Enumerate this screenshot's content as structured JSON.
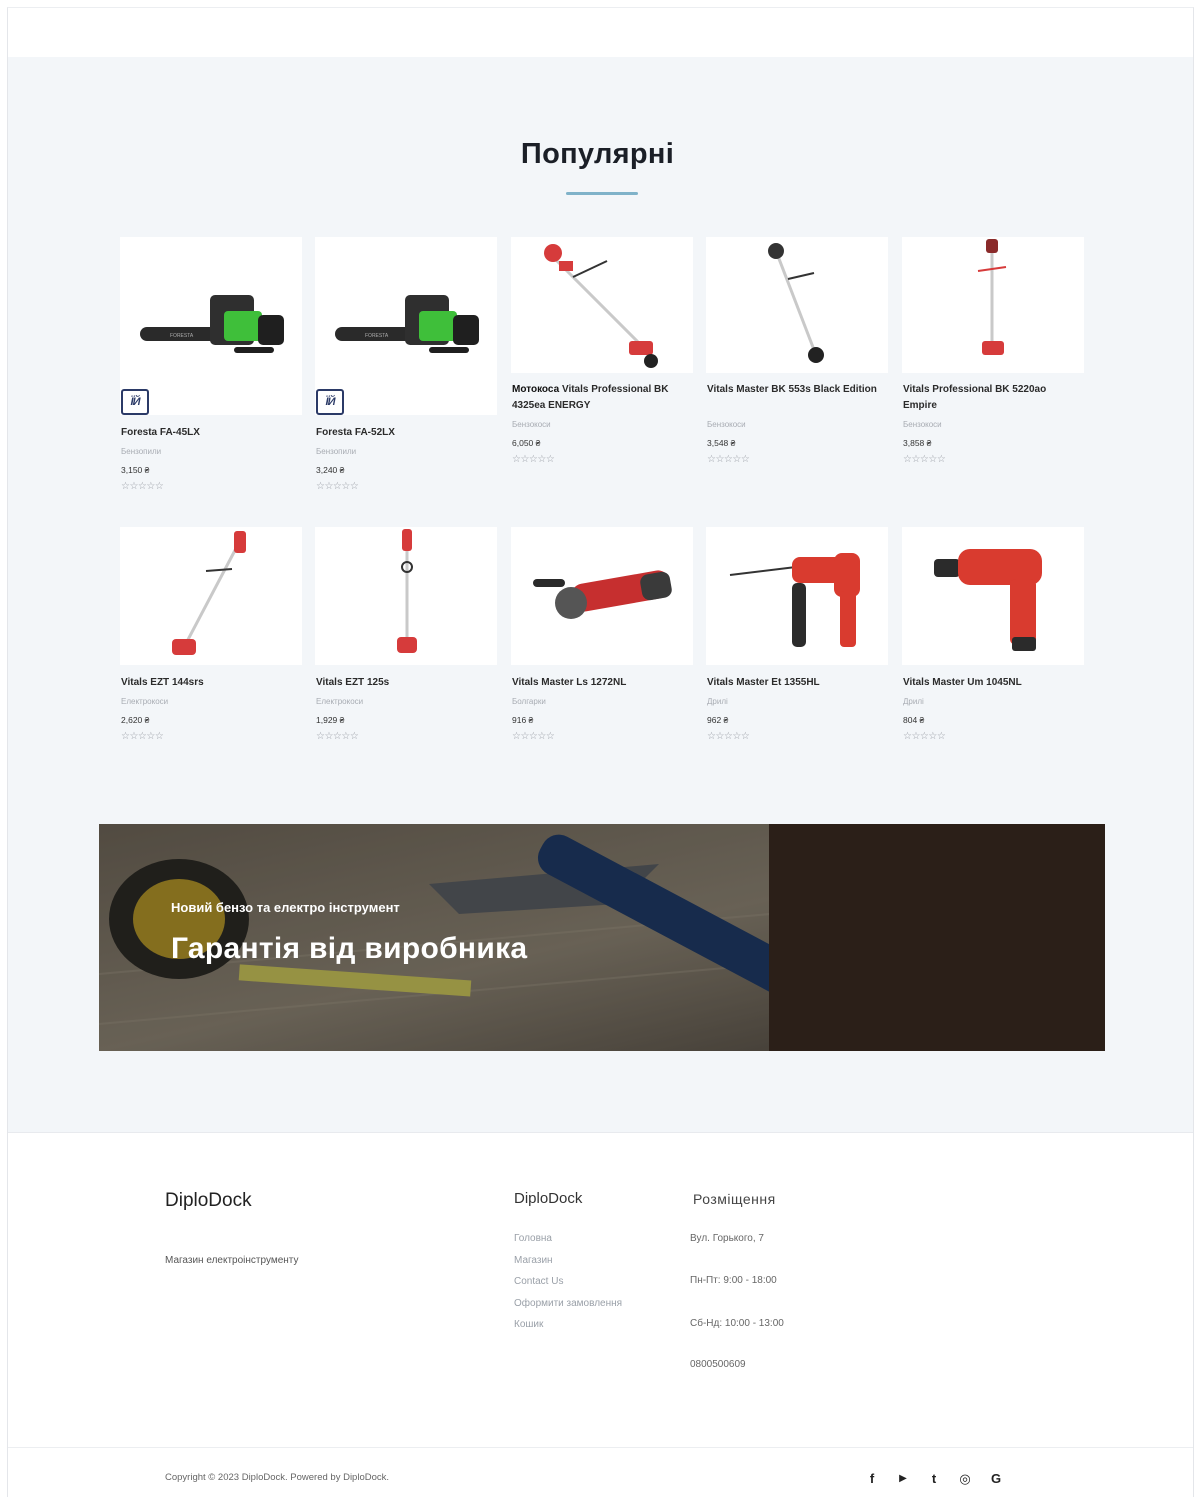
{
  "section": {
    "title": "Популярні"
  },
  "products": [
    {
      "name_bold": "",
      "name": "Foresta FA-45LX",
      "category": "Бензопили",
      "price": "3,150 ₴",
      "rating": "☆☆☆☆☆",
      "badge": true
    },
    {
      "name_bold": "",
      "name": "Foresta FA-52LX",
      "category": "Бензопили",
      "price": "3,240 ₴",
      "rating": "☆☆☆☆☆",
      "badge": true
    },
    {
      "name_bold": "Мотокоса",
      "name": "Vitals Professional BK 4325ea ENERGY",
      "category": "Бензокоси",
      "price": "6,050 ₴",
      "rating": "☆☆☆☆☆",
      "badge": false
    },
    {
      "name_bold": "",
      "name": "Vitals Master BK 553s Black Edition",
      "category": "Бензокоси",
      "price": "3,548 ₴",
      "rating": "☆☆☆☆☆",
      "badge": false
    },
    {
      "name_bold": "",
      "name": "Vitals Professional BK 5220ao Empire",
      "category": "Бензокоси",
      "price": "3,858 ₴",
      "rating": "☆☆☆☆☆",
      "badge": false
    },
    {
      "name_bold": "",
      "name": "Vitals EZT 144srs",
      "category": "Електрокоси",
      "price": "2,620 ₴",
      "rating": "☆☆☆☆☆",
      "badge": false
    },
    {
      "name_bold": "",
      "name": "Vitals EZT 125s",
      "category": "Електрокоси",
      "price": "1,929 ₴",
      "rating": "☆☆☆☆☆",
      "badge": false
    },
    {
      "name_bold": "",
      "name": "Vitals Master Ls 1272NL",
      "category": "Болгарки",
      "price": "916 ₴",
      "rating": "☆☆☆☆☆",
      "badge": false
    },
    {
      "name_bold": "",
      "name": "Vitals Master Et 1355HL",
      "category": "Дрилі",
      "price": "962 ₴",
      "rating": "☆☆☆☆☆",
      "badge": false
    },
    {
      "name_bold": "",
      "name": "Vitals Master Um 1045NL",
      "category": "Дрилі",
      "price": "804 ₴",
      "rating": "☆☆☆☆☆",
      "badge": false
    }
  ],
  "badge_text": "ЇЙ",
  "banner": {
    "subtitle": "Новий бензо та електро інструмент",
    "title": "Гарантія від виробника"
  },
  "footer": {
    "brand": "DiploDock",
    "description": "Магазин електроінструменту",
    "col2_title": "DiploDock",
    "links": [
      "Головна",
      "Магазин",
      "Contact Us",
      "Оформити замовлення",
      "Кошик"
    ],
    "col3_title": "Розміщення",
    "address": "Вул. Горького, 7",
    "hours_weekdays": "Пн-Пт: 9:00 - 18:00",
    "hours_weekend": "Сб-Нд: 10:00 - 13:00",
    "phone": "0800500609",
    "copyright": "Copyright © 2023 DiploDock. Powered by DiploDock.",
    "social": [
      "f",
      "▶",
      "t",
      "◎",
      "G"
    ]
  },
  "colors": {
    "accent": "#7fb2c9",
    "background": "#f3f6f9",
    "badge": "#2b3a67"
  }
}
